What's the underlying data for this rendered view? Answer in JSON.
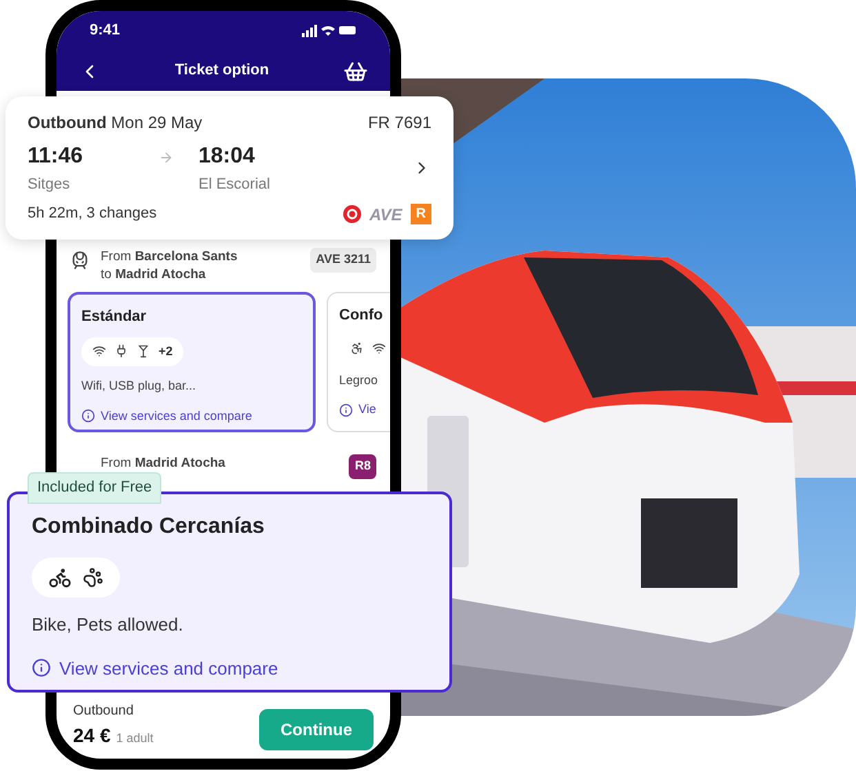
{
  "status_bar": {
    "time": "9:41"
  },
  "header": {
    "title": "Ticket option"
  },
  "journey_card": {
    "direction": "Outbound",
    "date": "Mon 29 May",
    "code": "FR 7691",
    "depart_time": "11:46",
    "arrive_time": "18:04",
    "from": "Sitges",
    "to": "El Escorial",
    "summary": "5h 22m, 3 changes",
    "operators": [
      "AVE",
      "R"
    ]
  },
  "legs": [
    {
      "lines": [
        "From **Barcelona Sants**",
        "to **Madrid Atocha**"
      ],
      "badge": "AVE 3211",
      "color": "#ececec"
    },
    {
      "lines": [
        "From **Madrid Atocha**"
      ],
      "badge": "R8",
      "color": "#8a1f6f"
    }
  ],
  "fares": [
    {
      "name": "Estándar",
      "more": "+2",
      "description": "Wifi, USB plug, bar...",
      "link": "View services and compare",
      "selected": true
    },
    {
      "name": "Confo",
      "description": "Legroo",
      "link": "Vie",
      "selected": false
    }
  ],
  "included_card": {
    "badge": "Included for Free",
    "title": "Combinado Cercanías",
    "description": "Bike, Pets allowed.",
    "link": "View services and compare"
  },
  "footer": {
    "label": "Outbound",
    "price": "24 €",
    "passengers": "1 adult",
    "button": "Continue"
  }
}
